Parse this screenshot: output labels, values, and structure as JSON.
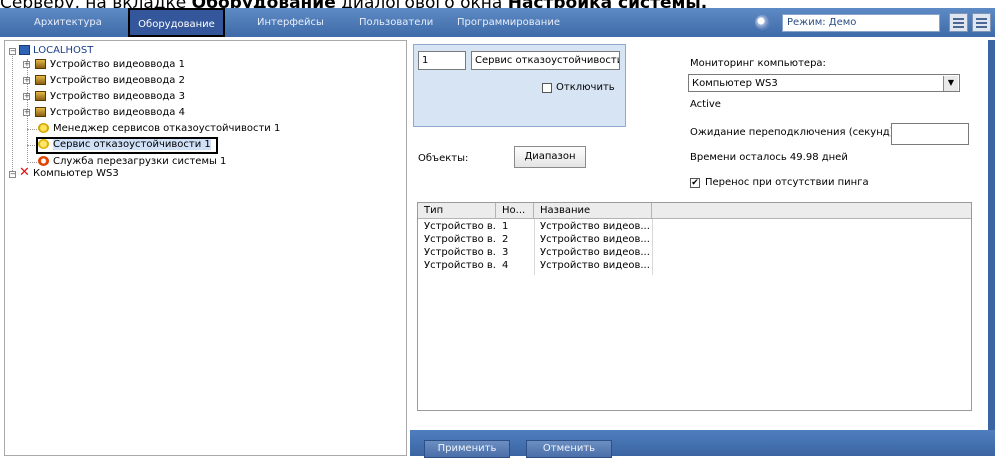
{
  "caption": {
    "prefix": "Серверу, на вкладке ",
    "bold1": "Оборудование",
    "middle": " диалогового окна ",
    "bold2": "Настройка системы."
  },
  "tabs": [
    "Архитектура",
    "Оборудование",
    "Интерфейсы",
    "Пользователи",
    "Программирование"
  ],
  "mode_label": "Режим: Демо",
  "tree": {
    "root": "LOCALHOST",
    "children": [
      "Устройство видеоввода 1",
      "Устройство видеоввода 2",
      "Устройство видеоввода 3",
      "Устройство видеоввода 4",
      "Менеджер сервисов отказоустойчивости 1",
      "Сервис отказоустойчивости 1",
      "Служба перезагрузки системы 1"
    ],
    "second_root": "Компьютер WS3"
  },
  "form": {
    "id_value": "1",
    "name_value": "Сервис отказоустойчивости",
    "disable_label": "Отключить",
    "monitoring_label": "Мониторинг компьютера:",
    "monitoring_value": "Компьютер WS3",
    "status": "Active",
    "reconnect_label": "Ожидание переподключения (секунд)",
    "reconnect_value": "",
    "remaining": "Времени осталось 49.98 дней",
    "objects_label": "Объекты:",
    "range_button": "Диапазон",
    "ping_label": "Перенос при отсутствии пинга"
  },
  "table": {
    "headers": [
      "Тип",
      "Но...",
      "Название"
    ],
    "rows": [
      [
        "Устройство в...",
        "1",
        "Устройство видеов..."
      ],
      [
        "Устройство в...",
        "2",
        "Устройство видеов..."
      ],
      [
        "Устройство в...",
        "3",
        "Устройство видеов..."
      ],
      [
        "Устройство в...",
        "4",
        "Устройство видеов..."
      ]
    ]
  },
  "buttons": {
    "apply": "Применить",
    "cancel": "Отменить"
  },
  "colors": {
    "tabbar": "#4a78b8",
    "selection_border": "#000000",
    "panel_box": "#d6e4f4"
  }
}
